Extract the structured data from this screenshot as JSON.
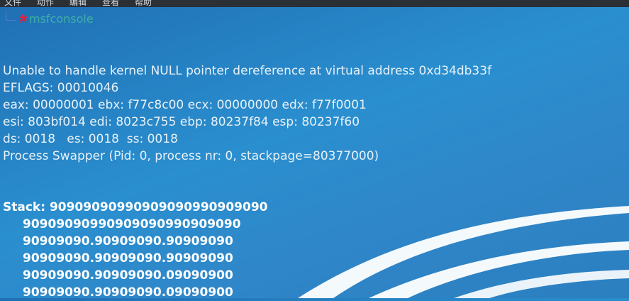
{
  "menubar": {
    "items": [
      "文件",
      "动作",
      "编辑",
      "查看",
      "帮助"
    ]
  },
  "prompt": {
    "symbol": "#",
    "command": "msfconsole"
  },
  "output_lines": [
    "Unable to handle kernel NULL pointer dereference at virtual address 0xd34db33f",
    "EFLAGS: 00010046",
    "eax: 00000001 ebx: f77c8c00 ecx: 00000000 edx: f77f0001",
    "esi: 803bf014 edi: 8023c755 ebp: 80237f84 esp: 80237f60",
    "ds: 0018   es: 0018  ss: 0018",
    "Process Swapper (Pid: 0, process nr: 0, stackpage=80377000)"
  ],
  "stack": {
    "label": "Stack: 90909090990909090990909090",
    "lines": [
      "90909090990909090990909090",
      "90909090.90909090.90909090",
      "90909090.90909090.90909090",
      "90909090.90909090.09090900",
      "90909090.90909090.09090900"
    ]
  }
}
